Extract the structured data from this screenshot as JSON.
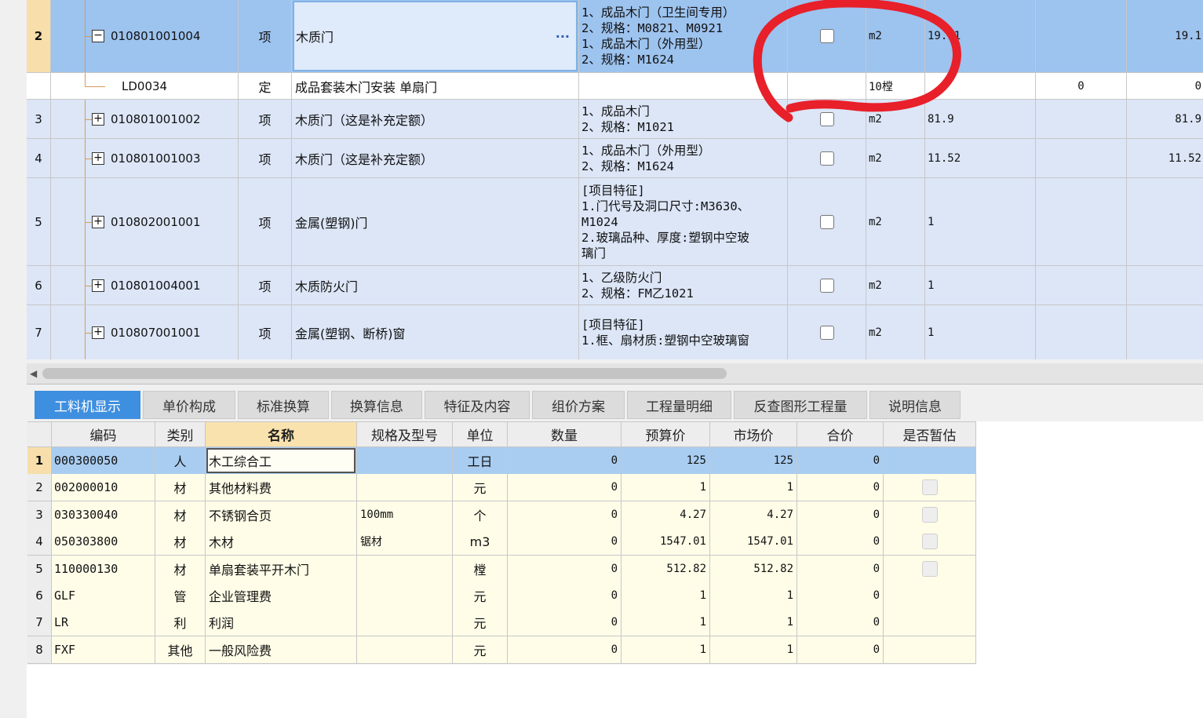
{
  "top_rows": [
    {
      "no": "2",
      "code": "010801001004",
      "expand": "−",
      "type": "项",
      "name": "木质门",
      "features": [
        "1、成品木门（卫生间专用）",
        "2、规格：M0821、M0921",
        "1、成品木门（外用型）",
        "2、规格：M1624"
      ],
      "unit": "m2",
      "qty": "19.11",
      "x1": "",
      "x2": "19.1",
      "checkbox": true,
      "selected": true
    },
    {
      "no": "",
      "code": "LD0034",
      "expand": "",
      "type": "定",
      "name": "成品套装木门安装 单扇门",
      "features": [],
      "unit": "10樘",
      "qty": "",
      "x1": "0",
      "x2": "0",
      "checkbox": false,
      "selected": false
    },
    {
      "no": "3",
      "code": "010801001002",
      "expand": "+",
      "type": "项",
      "name": "木质门（这是补充定额）",
      "features": [
        "1、成品木门",
        "2、规格：M1021"
      ],
      "unit": "m2",
      "qty": "81.9",
      "x1": "",
      "x2": "81.9",
      "checkbox": true,
      "selected": false
    },
    {
      "no": "4",
      "code": "010801001003",
      "expand": "+",
      "type": "项",
      "name": "木质门（这是补充定额）",
      "features": [
        "1、成品木门（外用型）",
        "2、规格：M1624"
      ],
      "unit": "m2",
      "qty": "11.52",
      "x1": "",
      "x2": "11.52",
      "checkbox": true,
      "selected": false
    },
    {
      "no": "5",
      "code": "010802001001",
      "expand": "+",
      "type": "项",
      "name": "金属(塑钢)门",
      "features": [
        "[项目特征]",
        "1.门代号及洞口尺寸:M3630、",
        "M1024",
        "2.玻璃品种、厚度:塑钢中空玻",
        "璃门"
      ],
      "unit": "m2",
      "qty": "1",
      "x1": "",
      "x2": "",
      "checkbox": true,
      "selected": false
    },
    {
      "no": "6",
      "code": "010801004001",
      "expand": "+",
      "type": "项",
      "name": "木质防火门",
      "features": [
        "1、乙级防火门",
        "2、规格：FM乙1021"
      ],
      "unit": "m2",
      "qty": "1",
      "x1": "",
      "x2": "",
      "checkbox": true,
      "selected": false
    },
    {
      "no": "7",
      "code": "010807001001",
      "expand": "+",
      "type": "项",
      "name": "金属(塑钢、断桥)窗",
      "features": [
        "[项目特征]",
        "1.框、扇材质:塑钢中空玻璃窗"
      ],
      "unit": "m2",
      "qty": "1",
      "x1": "",
      "x2": "",
      "checkbox": true,
      "selected": false
    }
  ],
  "tabs": [
    "工料机显示",
    "单价构成",
    "标准换算",
    "换算信息",
    "特征及内容",
    "组价方案",
    "工程量明细",
    "反查图形工程量",
    "说明信息"
  ],
  "active_tab": "工料机显示",
  "bottom_headers": {
    "code": "编码",
    "category": "类别",
    "name": "名称",
    "spec": "规格及型号",
    "unit": "单位",
    "qty": "数量",
    "budget": "预算价",
    "market": "市场价",
    "total": "合价",
    "estimate": "是否暂估"
  },
  "bottom_rows": [
    {
      "no": "1",
      "code": "000300050",
      "category": "人",
      "name": "木工综合工",
      "spec": "",
      "unit": "工日",
      "qty": "0",
      "budget": "125",
      "market": "125",
      "total": "0",
      "estimate_checkbox": false,
      "selected": true
    },
    {
      "no": "2",
      "code": "002000010",
      "category": "材",
      "name": "其他材料费",
      "spec": "",
      "unit": "元",
      "qty": "0",
      "budget": "1",
      "market": "1",
      "total": "0",
      "estimate_checkbox": true,
      "selected": false
    },
    {
      "no": "3",
      "code": "030330040",
      "category": "材",
      "name": "不锈钢合页",
      "spec": "100mm",
      "unit": "个",
      "qty": "0",
      "budget": "4.27",
      "market": "4.27",
      "total": "0",
      "estimate_checkbox": true,
      "selected": false
    },
    {
      "no": "4",
      "code": "050303800",
      "category": "材",
      "name": "木材",
      "spec": "锯材",
      "unit": "m3",
      "qty": "0",
      "budget": "1547.01",
      "market": "1547.01",
      "total": "0",
      "estimate_checkbox": true,
      "selected": false
    },
    {
      "no": "5",
      "code": "110000130",
      "category": "材",
      "name": "单扇套装平开木门",
      "spec": "",
      "unit": "樘",
      "qty": "0",
      "budget": "512.82",
      "market": "512.82",
      "total": "0",
      "estimate_checkbox": true,
      "selected": false
    },
    {
      "no": "6",
      "code": "GLF",
      "category": "管",
      "name": "企业管理费",
      "spec": "",
      "unit": "元",
      "qty": "0",
      "budget": "1",
      "market": "1",
      "total": "0",
      "estimate_checkbox": false,
      "selected": false
    },
    {
      "no": "7",
      "code": "LR",
      "category": "利",
      "name": "利润",
      "spec": "",
      "unit": "元",
      "qty": "0",
      "budget": "1",
      "market": "1",
      "total": "0",
      "estimate_checkbox": false,
      "selected": false
    },
    {
      "no": "8",
      "code": "FXF",
      "category": "其他",
      "name": "一般风险费",
      "spec": "",
      "unit": "元",
      "qty": "0",
      "budget": "1",
      "market": "1",
      "total": "0",
      "estimate_checkbox": false,
      "selected": false
    }
  ],
  "colors": {
    "selected_row": "#9dc3ef",
    "row_blue": "#dce6f7",
    "tab_active": "#3e8fe0",
    "annotation": "#e8202a",
    "bottom_row": "#fffde8"
  },
  "icons": {
    "expand": "plus-box-icon",
    "collapse": "minus-box-icon",
    "more": "ellipsis-icon",
    "scroll_left": "caret-left-icon"
  }
}
